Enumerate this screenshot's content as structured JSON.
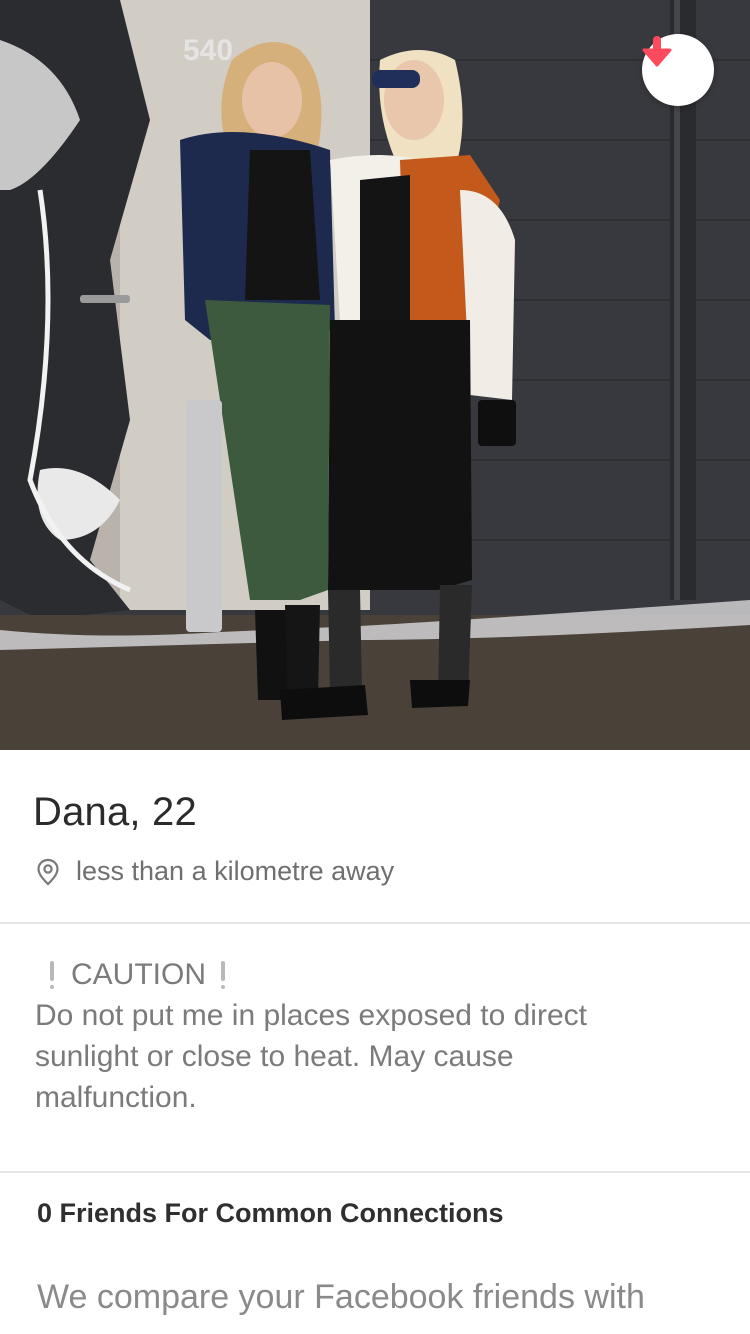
{
  "photo": {
    "alt": "Two women standing in front of a graffiti-painted door",
    "door_number": "540"
  },
  "header": {
    "collapse_icon": "arrow-down-icon",
    "accent_color": "#fe4a5d"
  },
  "profile": {
    "name_age": "Dana, 22",
    "distance": "less than a kilometre away",
    "distance_icon": "location-pin-icon"
  },
  "bio": {
    "caution_label": "CAUTION",
    "lines": [
      "Do not put me in places exposed to direct",
      "sunlight or close to heat. May cause",
      "malfunction."
    ]
  },
  "connections": {
    "title": "0 Friends For Common Connections",
    "description": "We compare your Facebook friends with"
  }
}
